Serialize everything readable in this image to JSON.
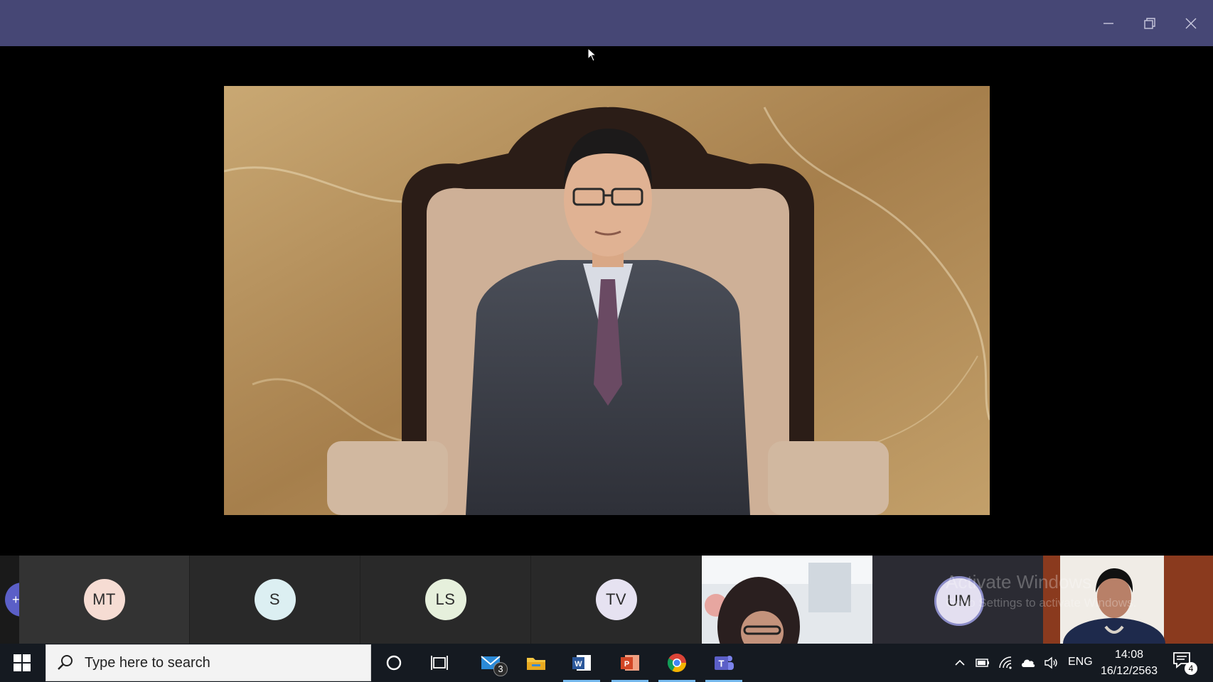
{
  "window": {
    "controls": {
      "minimize": "minimize-icon",
      "maximize": "restore-icon",
      "close": "close-icon"
    }
  },
  "stage": {
    "main_video": "participant-video"
  },
  "gallery": {
    "participants": [
      {
        "initials": "MT",
        "color": "#f6dcd3"
      },
      {
        "initials": "S",
        "color": "#dceff2"
      },
      {
        "initials": "LS",
        "color": "#e6f0dc"
      },
      {
        "initials": "TV",
        "color": "#e6e2f1"
      }
    ],
    "active_speaker": {
      "initials": "UM",
      "color": "#e3dff0",
      "ring": "#8b8cc7"
    }
  },
  "watermark": {
    "title": "Activate Windows",
    "subtitle": "Go to Settings to activate Windows."
  },
  "taskbar": {
    "search_placeholder": "Type here to search",
    "mail_badge": "3",
    "apps": [
      "cortana-icon",
      "task-view-icon",
      "mail-icon",
      "file-explorer-icon",
      "word-icon",
      "powerpoint-icon",
      "chrome-icon",
      "teams-icon"
    ],
    "tray": {
      "language": "ENG",
      "time": "14:08",
      "date": "16/12/2563",
      "notification_count": "4"
    }
  },
  "colors": {
    "titlebar": "#464775",
    "taskbar": "#151a21",
    "teams_accent": "#5b5fc7"
  }
}
